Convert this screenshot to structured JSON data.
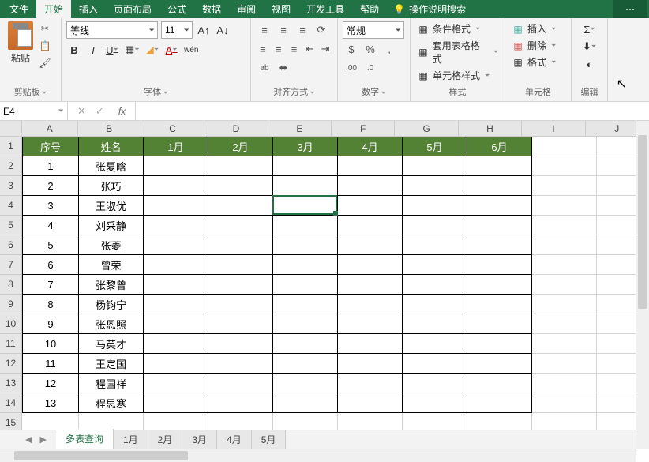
{
  "tabs": {
    "file": "文件",
    "home": "开始",
    "insert": "插入",
    "layout": "页面布局",
    "formula": "公式",
    "data": "数据",
    "review": "审阅",
    "view": "视图",
    "dev": "开发工具",
    "help": "帮助",
    "tellme": "操作说明搜索"
  },
  "ribbon": {
    "clipboard": {
      "paste": "粘贴",
      "label": "剪贴板"
    },
    "font": {
      "name": "等线",
      "size": "11",
      "label": "字体",
      "bold": "B",
      "italic": "I",
      "underline": "U",
      "ruby": "wén"
    },
    "align": {
      "label": "对齐方式",
      "wrap": "ab"
    },
    "number": {
      "format": "常规",
      "label": "数字",
      "currency": "%",
      "percent": "%"
    },
    "styles": {
      "cond": "条件格式",
      "table": "套用表格格式",
      "cell": "单元格样式",
      "label": "样式"
    },
    "cells": {
      "insert": "插入",
      "delete": "删除",
      "format": "格式",
      "label": "单元格"
    },
    "edit": {
      "label": "编辑",
      "sum": "Σ",
      "fill": "⬇"
    }
  },
  "namebox": "E4",
  "formula": "",
  "columns": [
    "A",
    "B",
    "C",
    "D",
    "E",
    "F",
    "G",
    "H",
    "I",
    "J"
  ],
  "headers": [
    "序号",
    "姓名",
    "1月",
    "2月",
    "3月",
    "4月",
    "5月",
    "6月"
  ],
  "rows": [
    {
      "n": "1",
      "name": "张夏晗"
    },
    {
      "n": "2",
      "name": "张巧"
    },
    {
      "n": "3",
      "name": "王淑优"
    },
    {
      "n": "4",
      "name": "刘采静"
    },
    {
      "n": "5",
      "name": "张菱"
    },
    {
      "n": "6",
      "name": "曾荣"
    },
    {
      "n": "7",
      "name": "张黎曾"
    },
    {
      "n": "8",
      "name": "杨钧宁"
    },
    {
      "n": "9",
      "name": "张恩照"
    },
    {
      "n": "10",
      "name": "马英才"
    },
    {
      "n": "11",
      "name": "王定国"
    },
    {
      "n": "12",
      "name": "程国祥"
    },
    {
      "n": "13",
      "name": "程思寒"
    }
  ],
  "sheets": {
    "active": "多表查询",
    "s1": "1月",
    "s2": "2月",
    "s3": "3月",
    "s4": "4月",
    "s5": "5月"
  },
  "active_cell": {
    "col": 4,
    "row": 3
  }
}
